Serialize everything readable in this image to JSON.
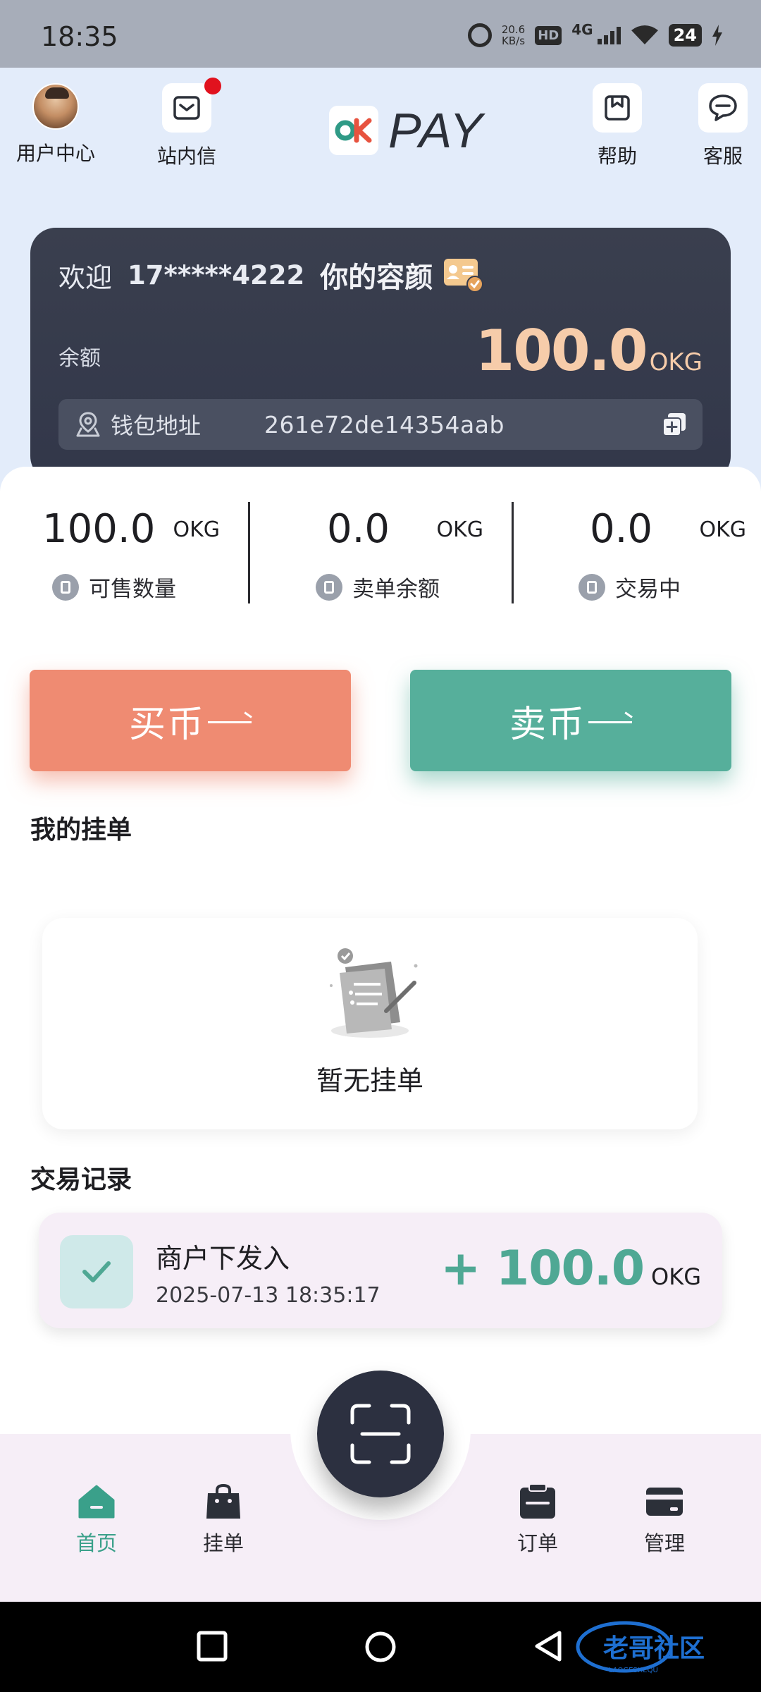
{
  "status_bar": {
    "time": "18:35",
    "net_speed_value": "20.6",
    "net_speed_unit": "KB/s",
    "hd": "HD",
    "network": "4G",
    "battery": "24"
  },
  "header": {
    "user_center": "用户中心",
    "messages": "站内信",
    "logo_text": "PAY",
    "help": "帮助",
    "service": "客服"
  },
  "balance_card": {
    "welcome": "欢迎",
    "phone": "17*****4222",
    "nickname": "你的容颜",
    "balance_label": "余额",
    "balance_value": "100.0",
    "balance_unit": "OKG",
    "wallet_label": "钱包地址",
    "wallet_address": "261e72de14354aab"
  },
  "stats": [
    {
      "value": "100.0",
      "unit": "OKG",
      "label": "可售数量"
    },
    {
      "value": "0.0",
      "unit": "OKG",
      "label": "卖单余额"
    },
    {
      "value": "0.0",
      "unit": "OKG",
      "label": "交易中"
    }
  ],
  "actions": {
    "buy": "买币",
    "sell": "卖币"
  },
  "my_orders": {
    "title": "我的挂单",
    "empty_text": "暂无挂单"
  },
  "records": {
    "title": "交易记录",
    "items": [
      {
        "title": "商户下发入",
        "time": "2025-07-13 18:35:17",
        "amount": "+ 100.0",
        "unit": "OKG"
      }
    ]
  },
  "bottom_nav": {
    "home": "首页",
    "orders_listing": "挂单",
    "orders": "订单",
    "manage": "管理",
    "active": "home"
  },
  "watermark": {
    "text": "老哥社区",
    "sub": "LAOGESHEQU"
  },
  "colors": {
    "accent": "#3aa08a",
    "buy": "#ef8b72",
    "sell": "#56af9b",
    "balance": "#f6ccaa",
    "card_dark": "#363b4c"
  }
}
